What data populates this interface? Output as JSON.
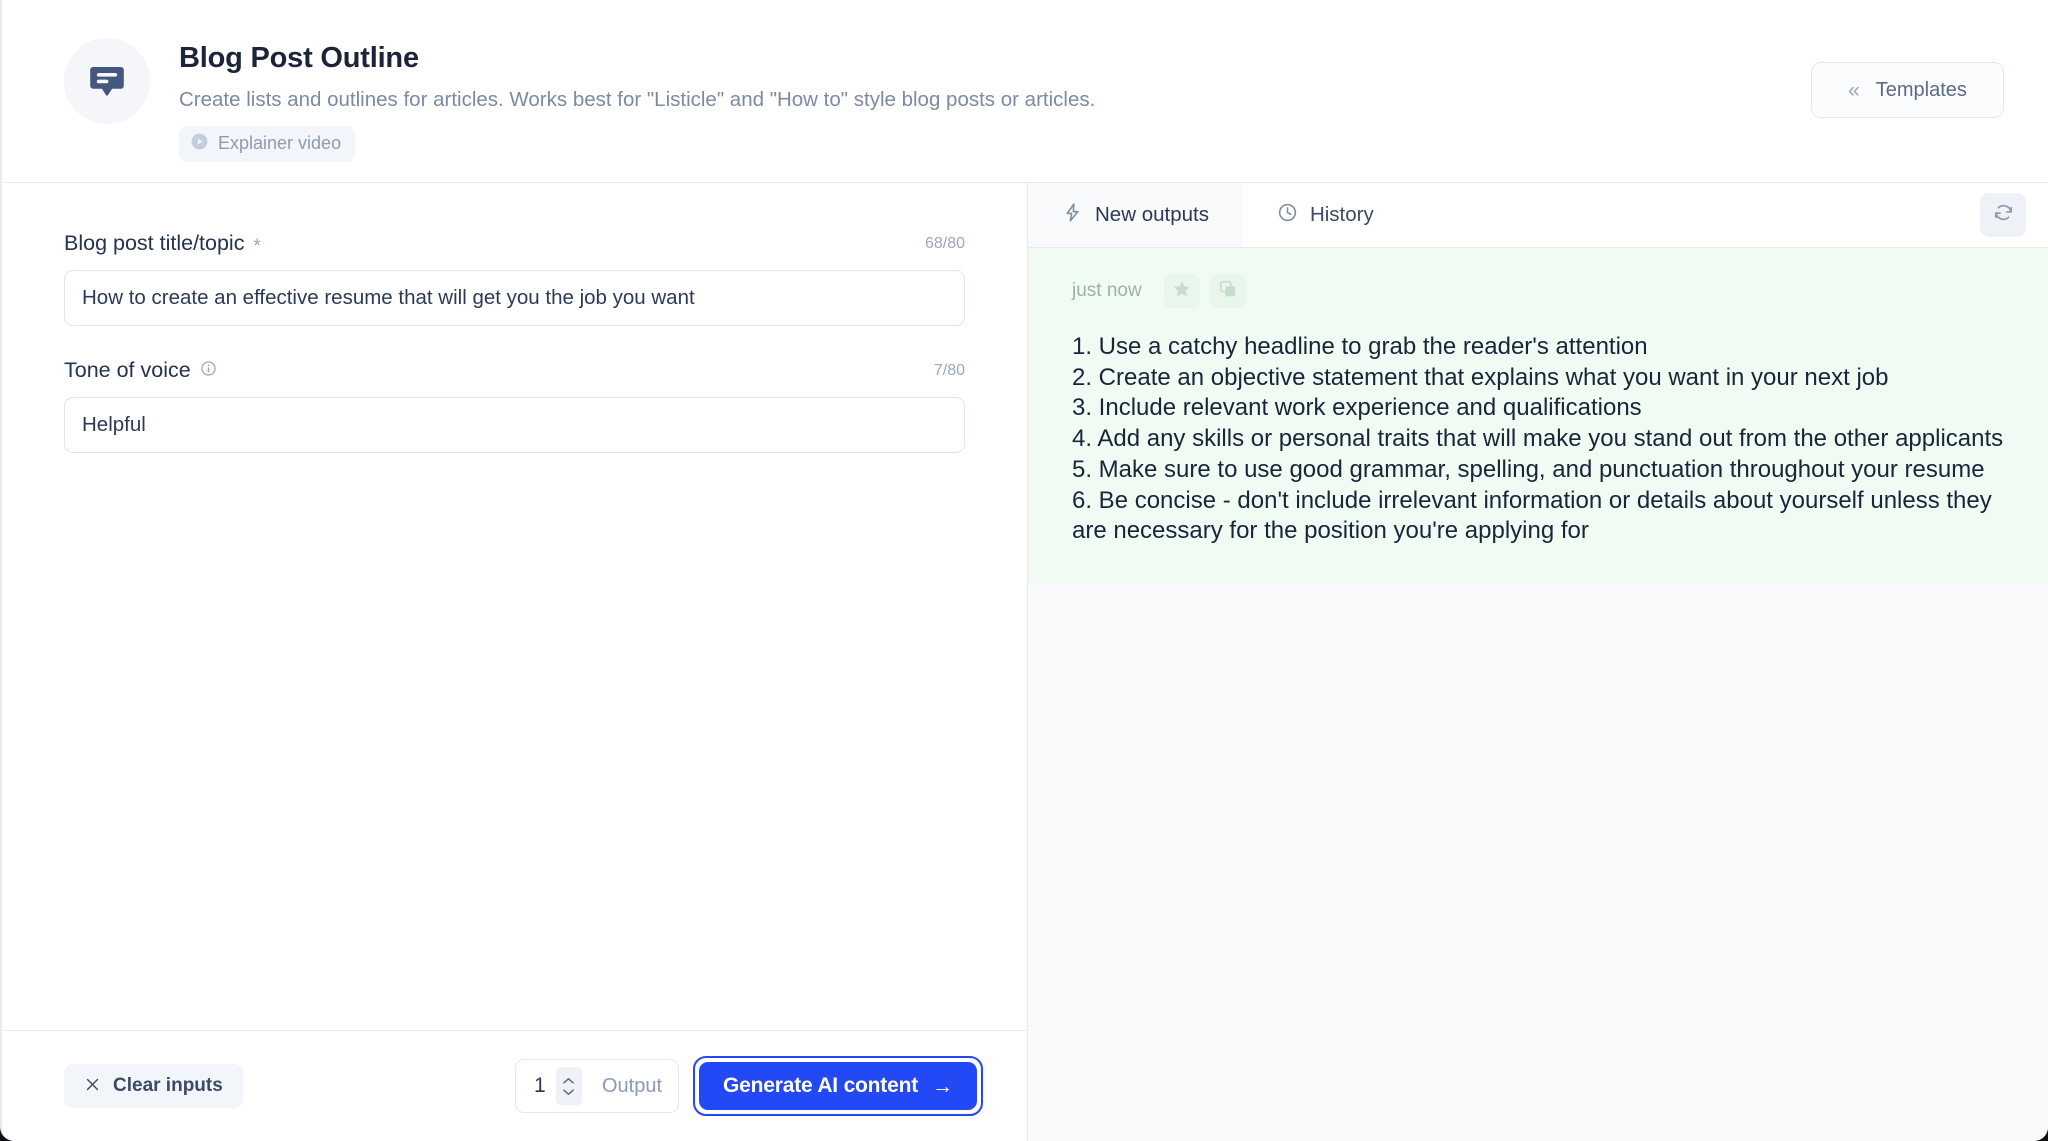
{
  "header": {
    "icon": "chat-bubble-icon",
    "title": "Blog Post Outline",
    "description": "Create lists and outlines for articles. Works best for \"Listicle\" and \"How to\" style blog posts or articles.",
    "explainer_badge": {
      "label": "Explainer video",
      "icon": "play-circle-icon"
    },
    "templates_button": {
      "label": "Templates",
      "icon": "chevrons-left-icon"
    }
  },
  "form": {
    "fields": [
      {
        "label": "Blog post title/topic",
        "required_marker": "*",
        "counter": "68/80",
        "value": "How to create an effective resume that will get you the job you want",
        "placeholder": "",
        "has_info_icon": false
      },
      {
        "label": "Tone of voice",
        "required_marker": "",
        "counter": "7/80",
        "value": "Helpful",
        "placeholder": "",
        "has_info_icon": true
      }
    ]
  },
  "action_bar": {
    "clear_button": {
      "label": "Clear inputs",
      "icon": "close-x-icon"
    },
    "output_count": "1",
    "output_label": "Output",
    "generate_button": {
      "label": "Generate AI content",
      "icon": "arrow-right-icon"
    }
  },
  "output_panel": {
    "tabs": [
      {
        "label": "New outputs",
        "icon": "lightning-bolt-icon",
        "active": true
      },
      {
        "label": "History",
        "icon": "clock-icon",
        "active": false
      }
    ],
    "refresh_icon": "refresh-icon",
    "card": {
      "timestamp": "just now",
      "star_icon": "star-icon",
      "copy_icon": "copy-icon",
      "text": "1. Use a catchy headline to grab the reader's attention\n2. Create an objective statement that explains what you want in your next job\n3. Include relevant work experience and qualifications\n4. Add any skills or personal traits that will make you stand out from the other applicants\n5. Make sure to use good grammar, spelling, and punctuation throughout your resume\n6. Be concise - don't include irrelevant information or details about yourself unless they are necessary for the position you're applying for"
    }
  },
  "colors": {
    "accent_blue": "#2348f5",
    "output_green_bg": "#f0fcf3",
    "panel_bg": "#f7f9fb",
    "icon_slate": "#46577f"
  }
}
